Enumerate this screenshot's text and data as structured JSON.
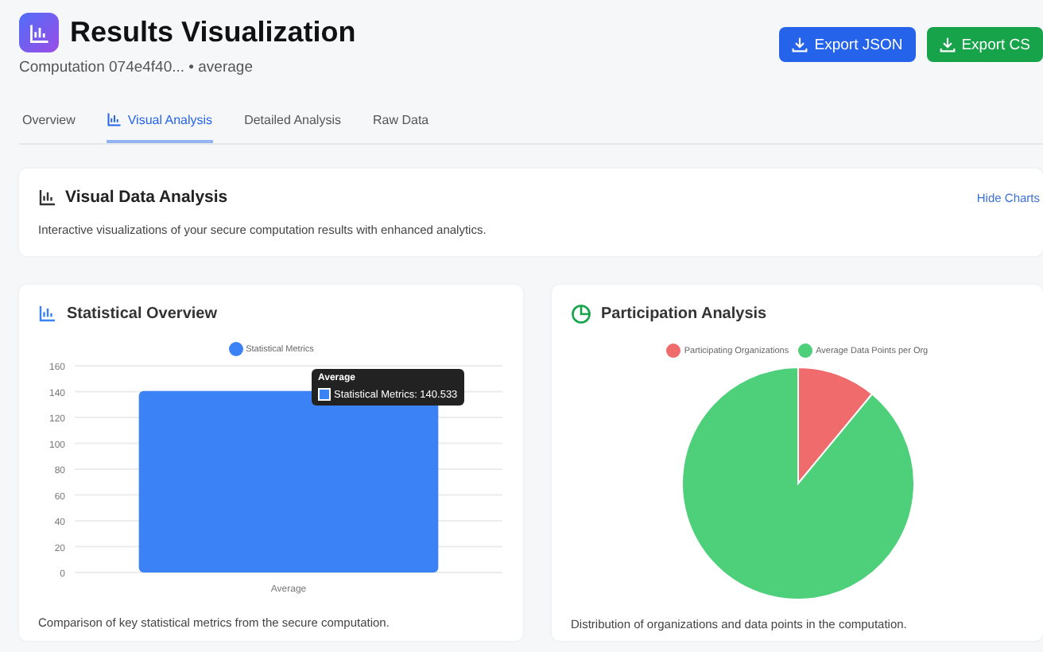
{
  "header": {
    "title": "Results Visualization",
    "subtitle": "Computation 074e4f40... • average",
    "buttons": [
      {
        "label": "Export JSON",
        "kind": "primary"
      },
      {
        "label": "Export CS",
        "kind": "success"
      }
    ]
  },
  "tabs": [
    {
      "label": "Overview",
      "selected": false,
      "icon": false
    },
    {
      "label": "Visual Analysis",
      "selected": true,
      "icon": true
    },
    {
      "label": "Detailed Analysis",
      "selected": false,
      "icon": false
    },
    {
      "label": "Raw Data",
      "selected": false,
      "icon": false
    }
  ],
  "intro": {
    "title": "Visual Data Analysis",
    "link": "Hide Charts",
    "description": "Interactive visualizations of your secure computation results with enhanced analytics."
  },
  "cards": [
    {
      "title": "Statistical Overview",
      "caption": "Comparison of key statistical metrics from the secure computation.",
      "tooltip": {
        "title": "Average",
        "text": "Statistical Metrics: 140.533",
        "color": "#3b82f6"
      },
      "chart_data": {
        "type": "bar",
        "categories": [
          "Average"
        ],
        "series": [
          {
            "name": "Statistical Metrics",
            "color": "#3b82f6",
            "values": [
              140.533
            ]
          }
        ],
        "ylim": [
          0,
          160
        ],
        "grid": true,
        "yticks": [
          0,
          20,
          40,
          60,
          80,
          100,
          120,
          140,
          160
        ]
      }
    },
    {
      "title": "Participation Analysis",
      "caption": "Distribution of organizations and data points in the computation.",
      "chart_data": {
        "type": "pie",
        "categories": [
          "Participating Organizations",
          "Average Data Points per Org"
        ],
        "values": [
          11,
          89
        ],
        "colors": [
          "#f06b6b",
          "#4ecf7a"
        ],
        "legend": true
      }
    }
  ]
}
